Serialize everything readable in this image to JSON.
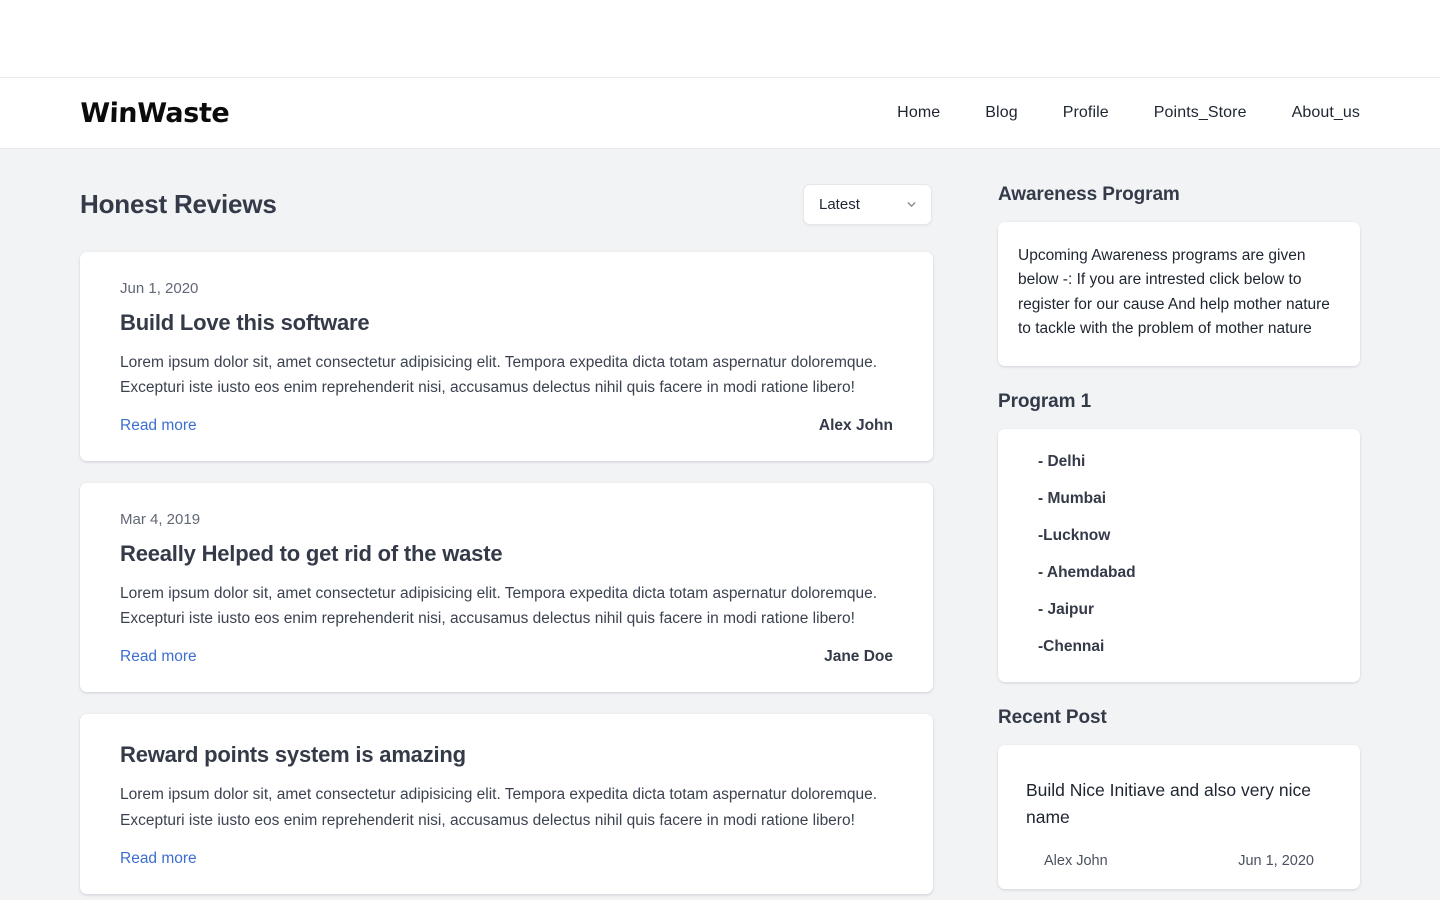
{
  "header": {
    "brand": "WinWaste",
    "nav": [
      {
        "label": "Home"
      },
      {
        "label": "Blog"
      },
      {
        "label": "Profile"
      },
      {
        "label": "Points_Store"
      },
      {
        "label": "About_us"
      }
    ]
  },
  "main": {
    "title": "Honest Reviews",
    "sort": {
      "selected": "Latest",
      "icon": "chevron-down-icon",
      "options": [
        "Latest"
      ]
    },
    "read_more_label": "Read more",
    "reviews": [
      {
        "date": "Jun 1, 2020",
        "title": "Build Love this software",
        "body": "Lorem ipsum dolor sit, amet consectetur adipisicing elit. Tempora expedita dicta totam aspernatur doloremque. Excepturi iste iusto eos enim reprehenderit nisi, accusamus delectus nihil quis facere in modi ratione libero!",
        "author": "Alex John"
      },
      {
        "date": "Mar 4, 2019",
        "title": "Reeally Helped to get rid of the waste",
        "body": "Lorem ipsum dolor sit, amet consectetur adipisicing elit. Tempora expedita dicta totam aspernatur doloremque. Excepturi iste iusto eos enim reprehenderit nisi, accusamus delectus nihil quis facere in modi ratione libero!",
        "author": "Jane Doe"
      },
      {
        "date": "",
        "title": "Reward points system is amazing",
        "body": "Lorem ipsum dolor sit, amet consectetur adipisicing elit. Tempora expedita dicta totam aspernatur doloremque. Excepturi iste iusto eos enim reprehenderit nisi, accusamus delectus nihil quis facere in modi ratione libero!",
        "author": ""
      }
    ]
  },
  "sidebar": {
    "awareness": {
      "heading": "Awareness Program",
      "text": "Upcoming Awareness programs are given below -: If you are intrested click below to register for our cause And help mother nature to tackle with the problem of mother nature"
    },
    "program": {
      "heading": "Program 1",
      "cities": [
        "- Delhi",
        "- Mumbai",
        "-Lucknow",
        "- Ahemdabad",
        "- Jaipur",
        "-Chennai"
      ]
    },
    "recent": {
      "heading": "Recent Post",
      "post": {
        "title": "Build Nice Initiave and also very nice name",
        "author": "Alex John",
        "date": "Jun 1, 2020"
      }
    }
  },
  "colors": {
    "page_bg": "#f1f3f5",
    "card_bg": "#ffffff",
    "heading": "#343a48",
    "link": "#3d6fd0",
    "muted": "#616875"
  }
}
